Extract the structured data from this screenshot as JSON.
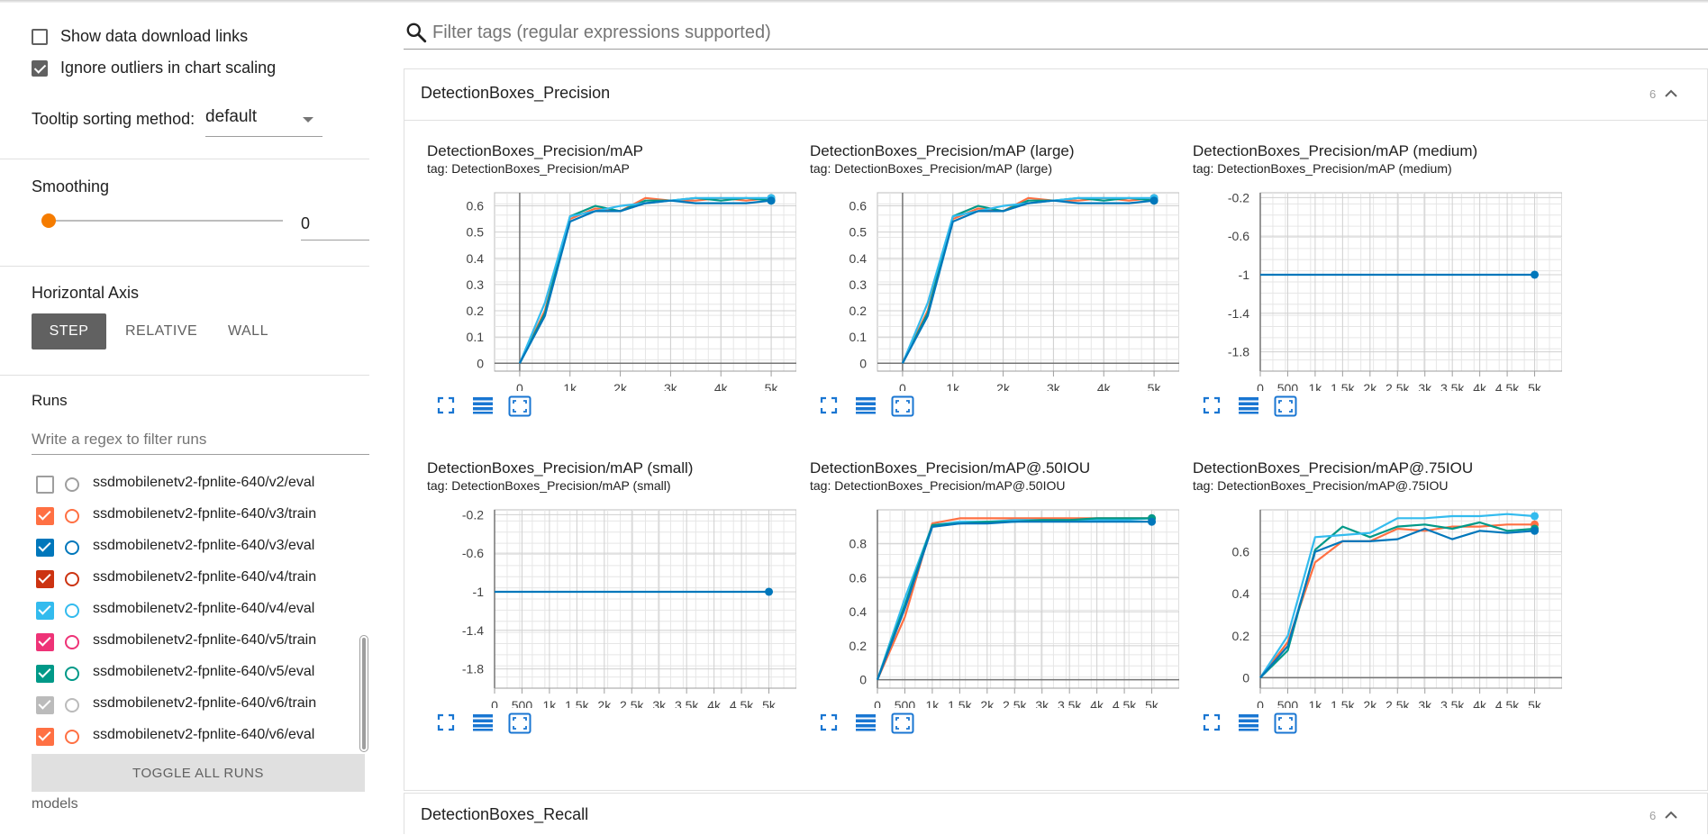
{
  "sidebar": {
    "show_download_label": "Show data download links",
    "show_download_checked": false,
    "ignore_outliers_label": "Ignore outliers in chart scaling",
    "ignore_outliers_checked": true,
    "tooltip_label": "Tooltip sorting method:",
    "tooltip_value": "default",
    "smoothing_label": "Smoothing",
    "smoothing_value": "0",
    "horizontal_axis_label": "Horizontal Axis",
    "axis_options": [
      "STEP",
      "RELATIVE",
      "WALL"
    ],
    "axis_selected": "STEP",
    "runs_label": "Runs",
    "runs_filter_placeholder": "Write a regex to filter runs",
    "runs": [
      {
        "name": "ssdmobilenetv2-fpnlite-640/v2/eval",
        "checked": false,
        "color": "#9e9e9e"
      },
      {
        "name": "ssdmobilenetv2-fpnlite-640/v3/train",
        "checked": true,
        "color": "#ff7043"
      },
      {
        "name": "ssdmobilenetv2-fpnlite-640/v3/eval",
        "checked": true,
        "color": "#0077bb"
      },
      {
        "name": "ssdmobilenetv2-fpnlite-640/v4/train",
        "checked": true,
        "color": "#cc3311"
      },
      {
        "name": "ssdmobilenetv2-fpnlite-640/v4/eval",
        "checked": true,
        "color": "#33bbee"
      },
      {
        "name": "ssdmobilenetv2-fpnlite-640/v5/train",
        "checked": true,
        "color": "#ee3377"
      },
      {
        "name": "ssdmobilenetv2-fpnlite-640/v5/eval",
        "checked": true,
        "color": "#009988"
      },
      {
        "name": "ssdmobilenetv2-fpnlite-640/v6/train",
        "checked": true,
        "color": "#bbbbbb"
      },
      {
        "name": "ssdmobilenetv2-fpnlite-640/v6/eval",
        "checked": true,
        "color": "#ff7043"
      }
    ],
    "toggle_all_label": "TOGGLE ALL RUNS",
    "footer_label": "models"
  },
  "search": {
    "placeholder": "Filter tags (regular expressions supported)"
  },
  "panels": [
    {
      "title": "DetectionBoxes_Precision",
      "count": "6"
    },
    {
      "title": "DetectionBoxes_Recall",
      "count": "6"
    }
  ],
  "colors": {
    "orange": "#ff7043",
    "blue": "#0077bb",
    "cyan": "#33bbee",
    "teal": "#009988",
    "accent": "#f57c00",
    "icon_blue": "#1976d2"
  },
  "chart_data": [
    {
      "type": "line",
      "title": "DetectionBoxes_Precision/mAP",
      "tag": "tag: DetectionBoxes_Precision/mAP",
      "xticks": [
        "0",
        "1k",
        "2k",
        "3k",
        "4k",
        "5k"
      ],
      "xlim": [
        -500,
        5500
      ],
      "yticks": [
        "0",
        "0.1",
        "0.2",
        "0.3",
        "0.4",
        "0.5",
        "0.6"
      ],
      "ylim": [
        -0.03,
        0.65
      ],
      "grid": true,
      "series": [
        {
          "color": "#ff7043",
          "x": [
            0,
            500,
            1000,
            1500,
            2000,
            2500,
            3000,
            3500,
            4000,
            4500,
            5000
          ],
          "y": [
            0,
            0.2,
            0.55,
            0.59,
            0.58,
            0.63,
            0.62,
            0.62,
            0.63,
            0.62,
            0.63
          ]
        },
        {
          "color": "#009988",
          "x": [
            0,
            500,
            1000,
            1500,
            2000,
            2500,
            3000,
            3500,
            4000,
            4500,
            5000
          ],
          "y": [
            0,
            0.19,
            0.56,
            0.6,
            0.58,
            0.62,
            0.62,
            0.63,
            0.62,
            0.63,
            0.62
          ]
        },
        {
          "color": "#33bbee",
          "x": [
            0,
            500,
            1000,
            1500,
            2000,
            2500,
            3000,
            3500,
            4000,
            4500,
            5000
          ],
          "y": [
            0,
            0.23,
            0.56,
            0.58,
            0.6,
            0.61,
            0.62,
            0.63,
            0.63,
            0.63,
            0.63
          ]
        },
        {
          "color": "#0077bb",
          "x": [
            0,
            500,
            1000,
            1500,
            2000,
            2500,
            3000,
            3500,
            4000,
            4500,
            5000
          ],
          "y": [
            0,
            0.18,
            0.54,
            0.58,
            0.58,
            0.61,
            0.62,
            0.61,
            0.61,
            0.61,
            0.62
          ]
        }
      ]
    },
    {
      "type": "line",
      "title": "DetectionBoxes_Precision/mAP (large)",
      "tag": "tag: DetectionBoxes_Precision/mAP (large)",
      "xticks": [
        "0",
        "1k",
        "2k",
        "3k",
        "4k",
        "5k"
      ],
      "xlim": [
        -500,
        5500
      ],
      "yticks": [
        "0",
        "0.1",
        "0.2",
        "0.3",
        "0.4",
        "0.5",
        "0.6"
      ],
      "ylim": [
        -0.03,
        0.65
      ],
      "grid": true,
      "series": [
        {
          "color": "#ff7043",
          "x": [
            0,
            500,
            1000,
            1500,
            2000,
            2500,
            3000,
            3500,
            4000,
            4500,
            5000
          ],
          "y": [
            0,
            0.2,
            0.55,
            0.59,
            0.58,
            0.63,
            0.62,
            0.62,
            0.63,
            0.62,
            0.63
          ]
        },
        {
          "color": "#009988",
          "x": [
            0,
            500,
            1000,
            1500,
            2000,
            2500,
            3000,
            3500,
            4000,
            4500,
            5000
          ],
          "y": [
            0,
            0.19,
            0.56,
            0.6,
            0.58,
            0.62,
            0.62,
            0.63,
            0.62,
            0.63,
            0.62
          ]
        },
        {
          "color": "#33bbee",
          "x": [
            0,
            500,
            1000,
            1500,
            2000,
            2500,
            3000,
            3500,
            4000,
            4500,
            5000
          ],
          "y": [
            0,
            0.23,
            0.56,
            0.58,
            0.6,
            0.61,
            0.62,
            0.63,
            0.63,
            0.63,
            0.63
          ]
        },
        {
          "color": "#0077bb",
          "x": [
            0,
            500,
            1000,
            1500,
            2000,
            2500,
            3000,
            3500,
            4000,
            4500,
            5000
          ],
          "y": [
            0,
            0.18,
            0.54,
            0.58,
            0.58,
            0.61,
            0.62,
            0.61,
            0.61,
            0.61,
            0.62
          ]
        }
      ]
    },
    {
      "type": "line",
      "title": "DetectionBoxes_Precision/mAP (medium)",
      "tag": "tag: DetectionBoxes_Precision/mAP (medium)",
      "xticks": [
        "0",
        "500",
        "1k",
        "1.5k",
        "2k",
        "2.5k",
        "3k",
        "3.5k",
        "4k",
        "4.5k",
        "5k"
      ],
      "xlim": [
        0,
        5500
      ],
      "yticks": [
        "-0.2",
        "-0.6",
        "-1",
        "-1.4",
        "-1.8"
      ],
      "ylim": [
        -2.0,
        -0.15
      ],
      "grid": true,
      "series": [
        {
          "color": "#0077bb",
          "x": [
            0,
            5000
          ],
          "y": [
            -1,
            -1
          ]
        }
      ]
    },
    {
      "type": "line",
      "title": "DetectionBoxes_Precision/mAP (small)",
      "tag": "tag: DetectionBoxes_Precision/mAP (small)",
      "xticks": [
        "0",
        "500",
        "1k",
        "1.5k",
        "2k",
        "2.5k",
        "3k",
        "3.5k",
        "4k",
        "4.5k",
        "5k"
      ],
      "xlim": [
        0,
        5500
      ],
      "yticks": [
        "-0.2",
        "-0.6",
        "-1",
        "-1.4",
        "-1.8"
      ],
      "ylim": [
        -2.0,
        -0.15
      ],
      "grid": true,
      "series": [
        {
          "color": "#0077bb",
          "x": [
            0,
            5000
          ],
          "y": [
            -1,
            -1
          ]
        }
      ]
    },
    {
      "type": "line",
      "title": "DetectionBoxes_Precision/mAP@.50IOU",
      "tag": "tag: DetectionBoxes_Precision/mAP@.50IOU",
      "xticks": [
        "0",
        "500",
        "1k",
        "1.5k",
        "2k",
        "2.5k",
        "3k",
        "3.5k",
        "4k",
        "4.5k",
        "5k"
      ],
      "xlim": [
        0,
        5500
      ],
      "yticks": [
        "0",
        "0.2",
        "0.4",
        "0.6",
        "0.8"
      ],
      "ylim": [
        -0.05,
        1.0
      ],
      "grid": true,
      "series": [
        {
          "color": "#ff7043",
          "x": [
            0,
            500,
            1000,
            1500,
            2000,
            2500,
            3000,
            3500,
            4000,
            4500,
            5000
          ],
          "y": [
            0,
            0.37,
            0.92,
            0.95,
            0.95,
            0.95,
            0.95,
            0.95,
            0.95,
            0.95,
            0.95
          ]
        },
        {
          "color": "#33bbee",
          "x": [
            0,
            500,
            1000,
            1500,
            2000,
            2500,
            3000,
            3500,
            4000,
            4500,
            5000
          ],
          "y": [
            0,
            0.48,
            0.91,
            0.93,
            0.93,
            0.94,
            0.94,
            0.94,
            0.94,
            0.94,
            0.95
          ]
        },
        {
          "color": "#009988",
          "x": [
            0,
            500,
            1000,
            1500,
            2000,
            2500,
            3000,
            3500,
            4000,
            4500,
            5000
          ],
          "y": [
            0,
            0.44,
            0.91,
            0.92,
            0.93,
            0.93,
            0.94,
            0.94,
            0.95,
            0.95,
            0.95
          ]
        },
        {
          "color": "#0077bb",
          "x": [
            0,
            500,
            1000,
            1500,
            2000,
            2500,
            3000,
            3500,
            4000,
            4500,
            5000
          ],
          "y": [
            0,
            0.42,
            0.9,
            0.92,
            0.92,
            0.93,
            0.93,
            0.93,
            0.93,
            0.93,
            0.93
          ]
        }
      ]
    },
    {
      "type": "line",
      "title": "DetectionBoxes_Precision/mAP@.75IOU",
      "tag": "tag: DetectionBoxes_Precision/mAP@.75IOU",
      "xticks": [
        "0",
        "500",
        "1k",
        "1.5k",
        "2k",
        "2.5k",
        "3k",
        "3.5k",
        "4k",
        "4.5k",
        "5k"
      ],
      "xlim": [
        0,
        5500
      ],
      "yticks": [
        "0",
        "0.2",
        "0.4",
        "0.6"
      ],
      "ylim": [
        -0.05,
        0.8
      ],
      "grid": true,
      "series": [
        {
          "color": "#ff7043",
          "x": [
            0,
            500,
            1000,
            1500,
            2000,
            2500,
            3000,
            3500,
            4000,
            4500,
            5000
          ],
          "y": [
            0,
            0.17,
            0.55,
            0.65,
            0.65,
            0.71,
            0.7,
            0.72,
            0.72,
            0.73,
            0.73
          ]
        },
        {
          "color": "#009988",
          "x": [
            0,
            500,
            1000,
            1500,
            2000,
            2500,
            3000,
            3500,
            4000,
            4500,
            5000
          ],
          "y": [
            0,
            0.13,
            0.61,
            0.72,
            0.67,
            0.72,
            0.73,
            0.71,
            0.74,
            0.7,
            0.71
          ]
        },
        {
          "color": "#33bbee",
          "x": [
            0,
            500,
            1000,
            1500,
            2000,
            2500,
            3000,
            3500,
            4000,
            4500,
            5000
          ],
          "y": [
            0,
            0.2,
            0.67,
            0.68,
            0.69,
            0.76,
            0.76,
            0.77,
            0.77,
            0.78,
            0.77
          ]
        },
        {
          "color": "#0077bb",
          "x": [
            0,
            500,
            1000,
            1500,
            2000,
            2500,
            3000,
            3500,
            4000,
            4500,
            5000
          ],
          "y": [
            0,
            0.15,
            0.6,
            0.65,
            0.65,
            0.66,
            0.71,
            0.66,
            0.7,
            0.69,
            0.7
          ]
        }
      ]
    }
  ]
}
